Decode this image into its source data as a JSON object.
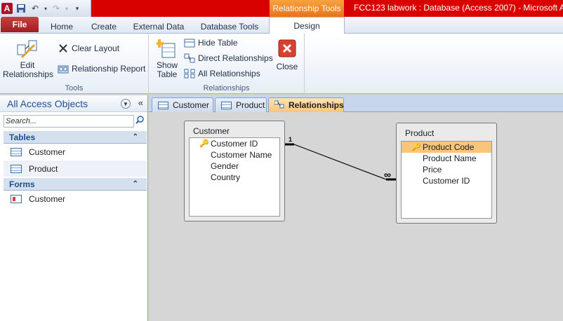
{
  "title_bar": {
    "context_tab": "Relationship Tools",
    "window_title": "FCC123 labwork : Database (Access 2007) - Microsoft Ac"
  },
  "ribbon_tabs": [
    "File",
    "Home",
    "Create",
    "External Data",
    "Database Tools",
    "Design"
  ],
  "ribbon": {
    "tools_group": {
      "label": "Tools",
      "edit_relationships": "Edit Relationships",
      "clear_layout": "Clear Layout",
      "relationship_report": "Relationship Report"
    },
    "relationships_group": {
      "label": "Relationships",
      "show_table": "Show Table",
      "hide_table": "Hide Table",
      "direct_relationships": "Direct Relationships",
      "all_relationships": "All Relationships",
      "close": "Close"
    }
  },
  "nav_pane": {
    "title": "All Access Objects",
    "search_placeholder": "Search...",
    "sections": [
      {
        "label": "Tables",
        "items": [
          "Customer",
          "Product"
        ]
      },
      {
        "label": "Forms",
        "items": [
          "Customer"
        ]
      }
    ]
  },
  "doc_tabs": [
    "Customer",
    "Product",
    "Relationships"
  ],
  "tables": [
    {
      "name": "Customer",
      "fields": [
        "Customer ID",
        "Customer Name",
        "Gender",
        "Country"
      ],
      "key_field": "Customer ID"
    },
    {
      "name": "Product",
      "fields": [
        "Product Code",
        "Product Name",
        "Price",
        "Customer ID"
      ],
      "key_field": "Product Code",
      "selected_field": "Product Code"
    }
  ],
  "relationship": {
    "from_table": "Customer",
    "to_table": "Product",
    "one_label": "1",
    "many_label": "∞"
  },
  "colors": {
    "title_red": "#d90000",
    "context_orange": "#e8731a",
    "selected_field": "#f9c57a"
  }
}
